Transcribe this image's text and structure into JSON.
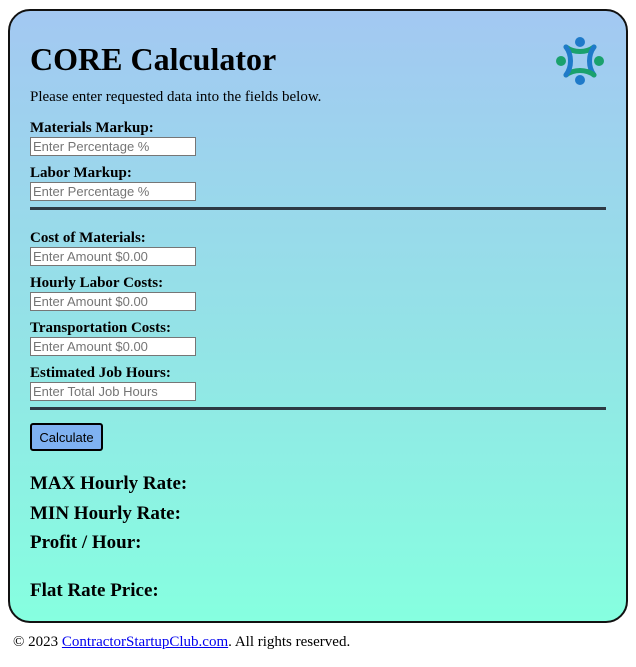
{
  "calculator": {
    "title": "CORE Calculator",
    "instructions": "Please enter requested data into the fields below.",
    "fields": [
      {
        "label": "Materials Markup:",
        "placeholder": "Enter Percentage %",
        "value": ""
      },
      {
        "label": "Labor Markup:",
        "placeholder": "Enter Percentage %",
        "value": ""
      },
      {
        "label": "Cost of Materials:",
        "placeholder": "Enter Amount $0.00",
        "value": ""
      },
      {
        "label": "Hourly Labor Costs:",
        "placeholder": "Enter Amount $0.00",
        "value": ""
      },
      {
        "label": "Transportation Costs:",
        "placeholder": "Enter Amount $0.00",
        "value": ""
      },
      {
        "label": "Estimated Job Hours:",
        "placeholder": "Enter Total Job Hours",
        "value": ""
      }
    ],
    "calculate_label": "Calculate",
    "results": [
      {
        "label": "MAX Hourly Rate:"
      },
      {
        "label": "MIN Hourly Rate:"
      },
      {
        "label": "Profit / Hour:"
      },
      {
        "label": "Flat Rate Price:"
      }
    ]
  },
  "footer": {
    "prefix": "© 2023 ",
    "link_text": "ContractorStartupClub.com",
    "suffix": ". All rights reserved."
  },
  "colors": {
    "gradient_top": "#a3c8f2",
    "gradient_bottom": "#86ffe0",
    "button_bg": "#7fb2f2",
    "logo_blue": "#1f7ac9",
    "logo_green": "#1aa16d"
  },
  "icons": {
    "logo": "people-circle-logo-icon"
  }
}
